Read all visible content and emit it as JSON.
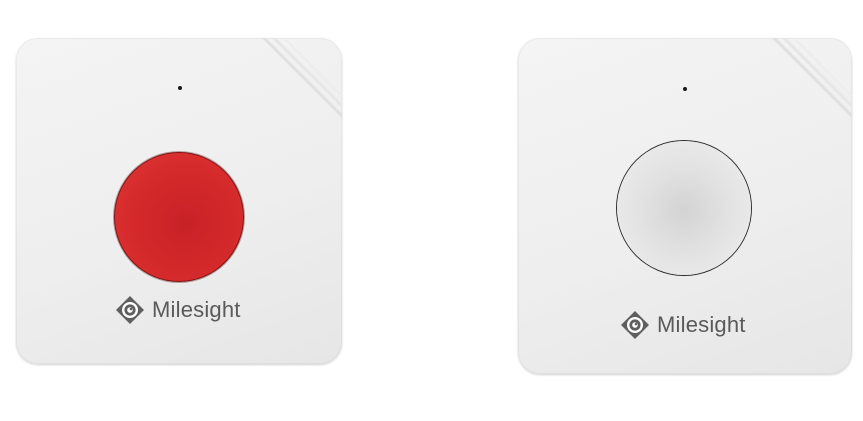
{
  "devices": [
    {
      "id": "left",
      "button_color": "#d52a2c",
      "brand": "Milesight"
    },
    {
      "id": "right",
      "button_color": "#e2e2e2",
      "brand": "Milesight"
    }
  ],
  "colors": {
    "background": "#ffffff",
    "casing": "#efefef",
    "brand_text": "#5a5a5a",
    "logo": "#5f5f5f"
  },
  "icons": {
    "logo": "milesight-diamond-eye-logo"
  }
}
